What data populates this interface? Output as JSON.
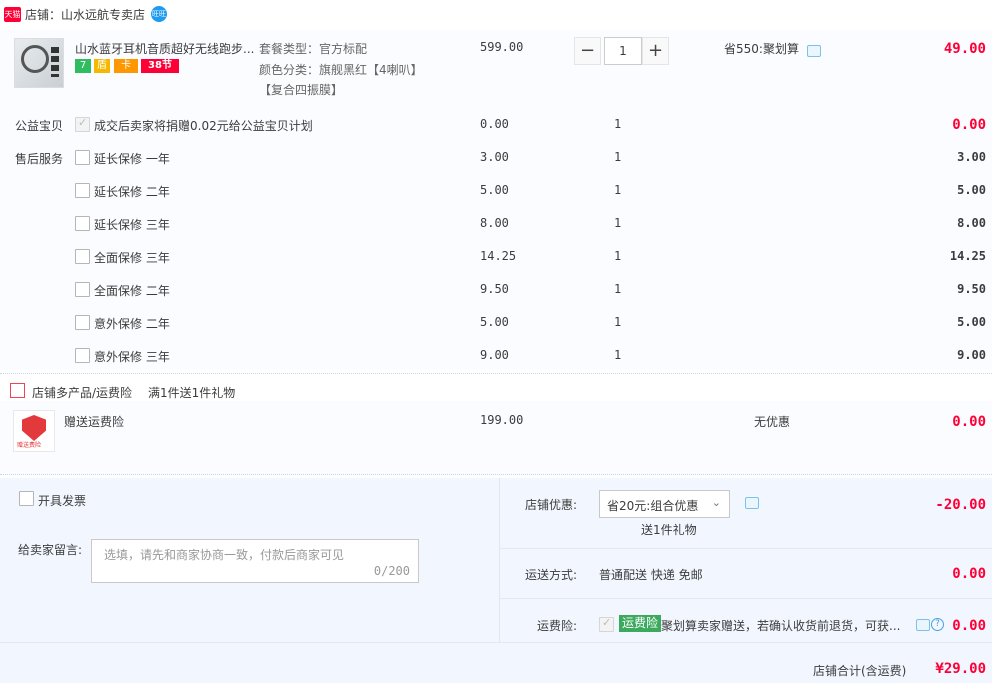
{
  "shop": {
    "badge": "天猫",
    "label": "店铺：山水远航专卖店",
    "ww_label": "旺旺"
  },
  "item": {
    "title": "山水蓝牙耳机音质超好无线跑步...",
    "tags": [
      "7",
      "盾",
      "卡",
      "38节"
    ],
    "sku_pkg": "套餐类型：官方标配",
    "sku_color": "颜色分类：旗舰黑红【4喇叭】",
    "sku_color2": "【复合四振膜】",
    "unit_price": "599.00",
    "qty": "1",
    "qty_minus": "−",
    "qty_plus": "+",
    "promo": "省550:聚划算",
    "subtotal": "49.00"
  },
  "services": {
    "charity_label": "公益宝贝",
    "after_sale_label": "售后服务",
    "rows": [
      {
        "name": "成交后卖家将捐赠0.02元给公益宝贝计划",
        "price": "0.00",
        "qty": "1",
        "total": "0.00"
      },
      {
        "name": "延长保修 一年",
        "price": "3.00",
        "qty": "1",
        "total": "3.00"
      },
      {
        "name": "延长保修 二年",
        "price": "5.00",
        "qty": "1",
        "total": "5.00"
      },
      {
        "name": "延长保修 三年",
        "price": "8.00",
        "qty": "1",
        "total": "8.00"
      },
      {
        "name": "全面保修 三年",
        "price": "14.25",
        "qty": "1",
        "total": "14.25"
      },
      {
        "name": "全面保修 二年",
        "price": "9.50",
        "qty": "1",
        "total": "9.50"
      },
      {
        "name": "意外保修 二年",
        "price": "5.00",
        "qty": "1",
        "total": "5.00"
      },
      {
        "name": "意外保修 三年",
        "price": "9.00",
        "qty": "1",
        "total": "9.00"
      }
    ]
  },
  "gift": {
    "promo_label": "店铺多产品/运费险",
    "promo_text": "满1件送1件礼物",
    "item_title": "赠送运费险",
    "item_img_text": "赠送费险",
    "price": "199.00",
    "discount": "无优惠",
    "total": "0.00"
  },
  "invoice": {
    "label": "开具发票"
  },
  "memo": {
    "label": "给卖家留言:",
    "placeholder": "选填，请先和商家协商一致，付款后商家可见",
    "count": "0/200"
  },
  "summary": {
    "coupon_label": "店铺优惠:",
    "coupon_value": "省20元:组合优惠",
    "coupon_gift": "送1件礼物",
    "coupon_amount": "-20.00",
    "shipping_label": "运送方式:",
    "shipping_value": "普通配送 快递 免邮",
    "shipping_amount": "0.00",
    "insure_label": "运费险:",
    "insure_tag": "运费险",
    "insure_text": "聚划算卖家赠送，若确认收货前退货，可获...",
    "insure_amount": "0.00",
    "total_label": "店铺合计(含运费)",
    "total_value": "¥29.00"
  }
}
